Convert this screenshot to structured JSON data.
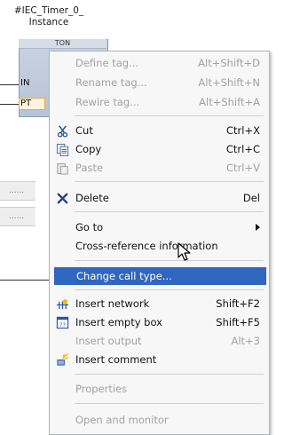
{
  "instance": {
    "title_line1": "#IEC_Timer_0_",
    "title_line2": "Instance",
    "block_header": "TON",
    "pin_in": "IN",
    "pin_pt": "PT",
    "placeholder_1": "......",
    "placeholder_2": "......"
  },
  "menu": {
    "define_tag": {
      "label": "Define tag...",
      "shortcut": "Alt+Shift+D",
      "enabled": false
    },
    "rename_tag": {
      "label": "Rename tag...",
      "shortcut": "Alt+Shift+N",
      "enabled": false
    },
    "rewire_tag": {
      "label": "Rewire tag...",
      "shortcut": "Alt+Shift+A",
      "enabled": false
    },
    "cut": {
      "label": "Cut",
      "shortcut": "Ctrl+X",
      "icon": "scissors-icon"
    },
    "copy": {
      "label": "Copy",
      "shortcut": "Ctrl+C",
      "icon": "copy-icon"
    },
    "paste": {
      "label": "Paste",
      "shortcut": "Ctrl+V",
      "icon": "paste-icon",
      "enabled": false
    },
    "delete": {
      "label": "Delete",
      "shortcut": "Del",
      "icon": "delete-x-icon"
    },
    "go_to": {
      "label": "Go to",
      "has_submenu": true
    },
    "cross_reference": {
      "label": "Cross-reference information"
    },
    "change_call_type": {
      "label": "Change call type...",
      "highlighted": true
    },
    "insert_network": {
      "label": "Insert network",
      "shortcut": "Shift+F2",
      "icon": "insert-network-icon"
    },
    "insert_empty_box": {
      "label": "Insert empty box",
      "shortcut": "Shift+F5",
      "icon": "empty-box-icon"
    },
    "insert_output": {
      "label": "Insert output",
      "shortcut": "Alt+3",
      "enabled": false
    },
    "insert_comment": {
      "label": "Insert comment",
      "icon": "comment-icon"
    },
    "properties": {
      "label": "Properties",
      "enabled": false
    },
    "open_and_monitor": {
      "label": "Open and monitor",
      "enabled": false
    }
  },
  "colors": {
    "highlight": "#2f66c0",
    "disabled_text": "#a2a2a2",
    "block_fill": "#c1cddc"
  }
}
